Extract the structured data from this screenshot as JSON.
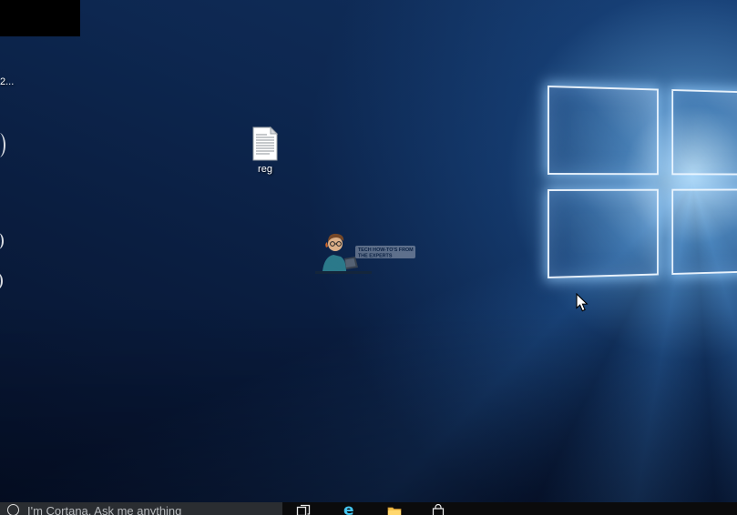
{
  "desktop": {
    "reg_icon": {
      "label": "reg"
    },
    "partial_label": "2...",
    "watermark": {
      "text_line1": "TECH HOW-TO'S FROM",
      "text_line2": "THE EXPERTS"
    }
  },
  "taskbar": {
    "cortana_text": "I'm Cortana. Ask me anything",
    "icons": [
      "task-view",
      "edge",
      "file-explorer",
      "store"
    ]
  },
  "colors": {
    "accent": "#0078d7",
    "taskbar_bg": "#0b0b0c",
    "search_bg": "#2a2d31",
    "wallpaper_glow": "#bfe3ff"
  }
}
